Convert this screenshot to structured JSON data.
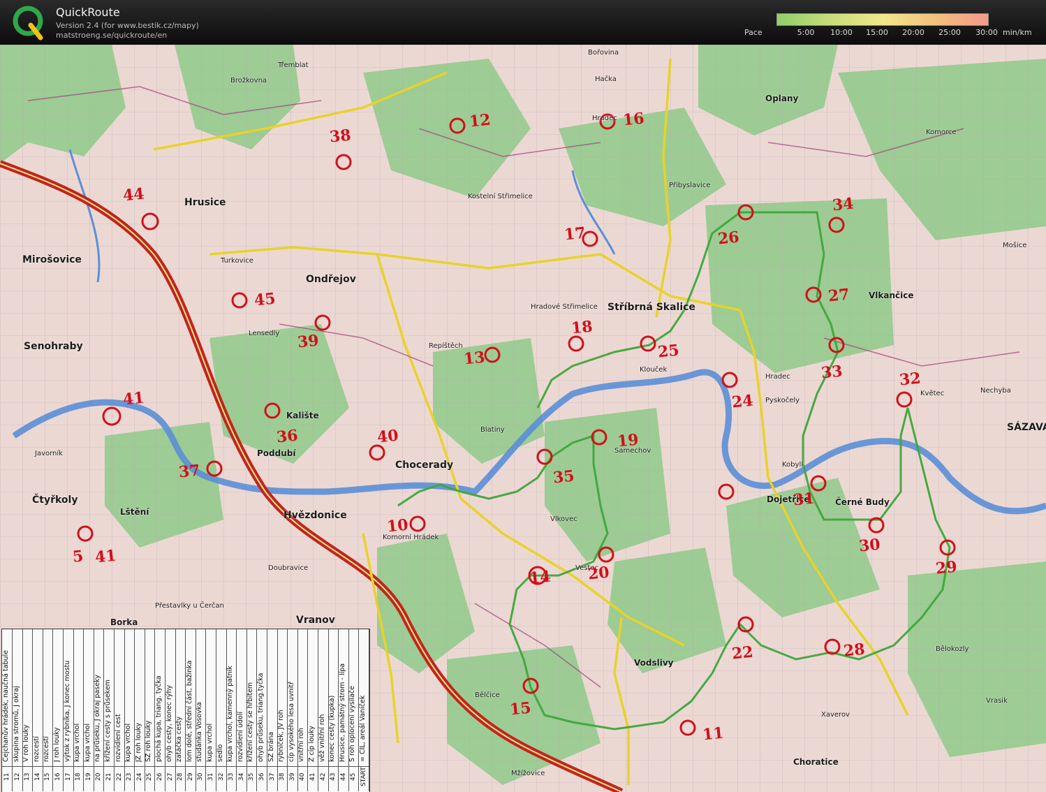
{
  "app": {
    "title": "QuickRoute",
    "version": "Version 2.4  (for www.bestik.cz/mapy)",
    "url": "matstroeng.se/quickroute/en"
  },
  "pace": {
    "label": "Pace",
    "ticks": [
      "5:00",
      "10:00",
      "15:00",
      "20:00",
      "25:00",
      "30:00"
    ],
    "unit": "min/km",
    "gradient_colors": [
      "#8fcf6a",
      "#c8dc7a",
      "#f0e88a",
      "#f4c07e",
      "#f39a8a"
    ]
  },
  "colors": {
    "route": "#3ea63a",
    "controls": "#d0101a",
    "motorway": "#c0251c",
    "river": "#5b8fd6",
    "forest": "#8dc98a",
    "road_yellow": "#e8d22a"
  },
  "places": [
    {
      "name": "Třemblat"
    },
    {
      "name": "Brožkovna"
    },
    {
      "name": "Bořovina"
    },
    {
      "name": "Hačka"
    },
    {
      "name": "Oplany"
    },
    {
      "name": "Hrusice"
    },
    {
      "name": "Mirošovice"
    },
    {
      "name": "Ondřejov"
    },
    {
      "name": "Senohraby"
    },
    {
      "name": "Lensedly"
    },
    {
      "name": "Turkovice"
    },
    {
      "name": "Hradec"
    },
    {
      "name": "Kostelní Střimelice"
    },
    {
      "name": "Hradové Střimelice"
    },
    {
      "name": "Stříbrná Skalice"
    },
    {
      "name": "Vlkančice"
    },
    {
      "name": "Kalište"
    },
    {
      "name": "Poddubí"
    },
    {
      "name": "Chocerady"
    },
    {
      "name": "Samechov"
    },
    {
      "name": "Čtyřkoly"
    },
    {
      "name": "Lštění"
    },
    {
      "name": "Hvězdonice"
    },
    {
      "name": "Komorní Hrádek"
    },
    {
      "name": "Vlkovec"
    },
    {
      "name": "Dojetřice"
    },
    {
      "name": "Černé Budy"
    },
    {
      "name": "SÁZAVA"
    },
    {
      "name": "Vestec"
    },
    {
      "name": "Doubravice"
    },
    {
      "name": "Přestavlky u Čerčan"
    },
    {
      "name": "Borka"
    },
    {
      "name": "Vranov"
    },
    {
      "name": "Vodslivy"
    },
    {
      "name": "Bělokozly"
    },
    {
      "name": "Xaverov"
    },
    {
      "name": "Choratice"
    },
    {
      "name": "Nechyba"
    },
    {
      "name": "Pyskočely"
    },
    {
      "name": "Javorník"
    },
    {
      "name": "Klouček"
    },
    {
      "name": "Repíštěch"
    },
    {
      "name": "Blatiny"
    },
    {
      "name": "Bělčice"
    },
    {
      "name": "Mžížovice"
    },
    {
      "name": "Vrasik"
    },
    {
      "name": "Květec"
    },
    {
      "name": "Mošice"
    },
    {
      "name": "Komorce"
    },
    {
      "name": "Přibyslavice"
    },
    {
      "name": "Hradec"
    },
    {
      "name": "Kobylí"
    }
  ],
  "controls": [
    "44",
    "38",
    "12",
    "16",
    "17",
    "34",
    "26",
    "45",
    "27",
    "39",
    "13",
    "18",
    "25",
    "33",
    "32",
    "41",
    "36",
    "24",
    "40",
    "19",
    "37",
    "35",
    "31",
    "30",
    "5",
    "41",
    "10",
    "20",
    "29",
    "14",
    "22",
    "28",
    "15",
    "11"
  ],
  "legend": {
    "rows": [
      {
        "num": "11",
        "text": "Čejchanův hrádek, naučná tabule"
      },
      {
        "num": "12",
        "text": "skupina stromů, J okraj"
      },
      {
        "num": "13",
        "text": "V roh louky"
      },
      {
        "num": "14",
        "text": "rozcestí"
      },
      {
        "num": "15",
        "text": "rozcestí"
      },
      {
        "num": "16",
        "text": "J roh louky"
      },
      {
        "num": "17",
        "text": "výtok z rybníka, J konec mostu"
      },
      {
        "num": "18",
        "text": "kupa vrchol"
      },
      {
        "num": "19",
        "text": "kupa vrchol"
      },
      {
        "num": "20",
        "text": "na průseku, J okraj paseky"
      },
      {
        "num": "21",
        "text": "křížení cesty s průsekem"
      },
      {
        "num": "22",
        "text": "rozvídlení cest"
      },
      {
        "num": "23",
        "text": "kupa vrchol"
      },
      {
        "num": "24",
        "text": "JZ roh louky"
      },
      {
        "num": "25",
        "text": "SZ roh louky"
      },
      {
        "num": "26",
        "text": "plochá kupa, triang. tyčka"
      },
      {
        "num": "27",
        "text": "ohyb cesty, konec rýhy"
      },
      {
        "num": "28",
        "text": "zatáčka cesty"
      },
      {
        "num": "29",
        "text": "lom dolé, střední část, bažinka"
      },
      {
        "num": "30",
        "text": "studánka Vosovka"
      },
      {
        "num": "31",
        "text": "kupa vrchol"
      },
      {
        "num": "32",
        "text": "sedlo"
      },
      {
        "num": "33",
        "text": "kupa vrchol, kamenný patník"
      },
      {
        "num": "34",
        "text": "rozvídlení údolí"
      },
      {
        "num": "35",
        "text": "křížení cesty se hřbitem"
      },
      {
        "num": "36",
        "text": "ohyb průseku, triang.tyčka"
      },
      {
        "num": "37",
        "text": "SZ brána"
      },
      {
        "num": "38",
        "text": "rybníček, JV roh"
      },
      {
        "num": "39",
        "text": "cíp vysokého lesa uvnitř"
      },
      {
        "num": "40",
        "text": "vnitřní roh"
      },
      {
        "num": "41",
        "text": "Z cíp louky"
      },
      {
        "num": "42",
        "text": "věž vnitřní roh"
      },
      {
        "num": "43",
        "text": "konec cesty (kupka)"
      },
      {
        "num": "44",
        "text": "Hrusice, památný strom - lípa"
      },
      {
        "num": "45",
        "text": "S roh oplocení vysílače"
      },
      {
        "num": "START",
        "text": "= CÍL, areál Vaníček"
      }
    ]
  }
}
